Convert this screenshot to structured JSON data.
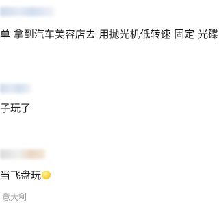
{
  "comments": [
    {
      "text": "单 拿到汽车美容店去 用抛光机低转速 固定 光碟"
    },
    {
      "text": "子玩了"
    },
    {
      "text": "当飞盘玩",
      "emoji": "smiling-face-emoji",
      "location": "意大利"
    }
  ]
}
